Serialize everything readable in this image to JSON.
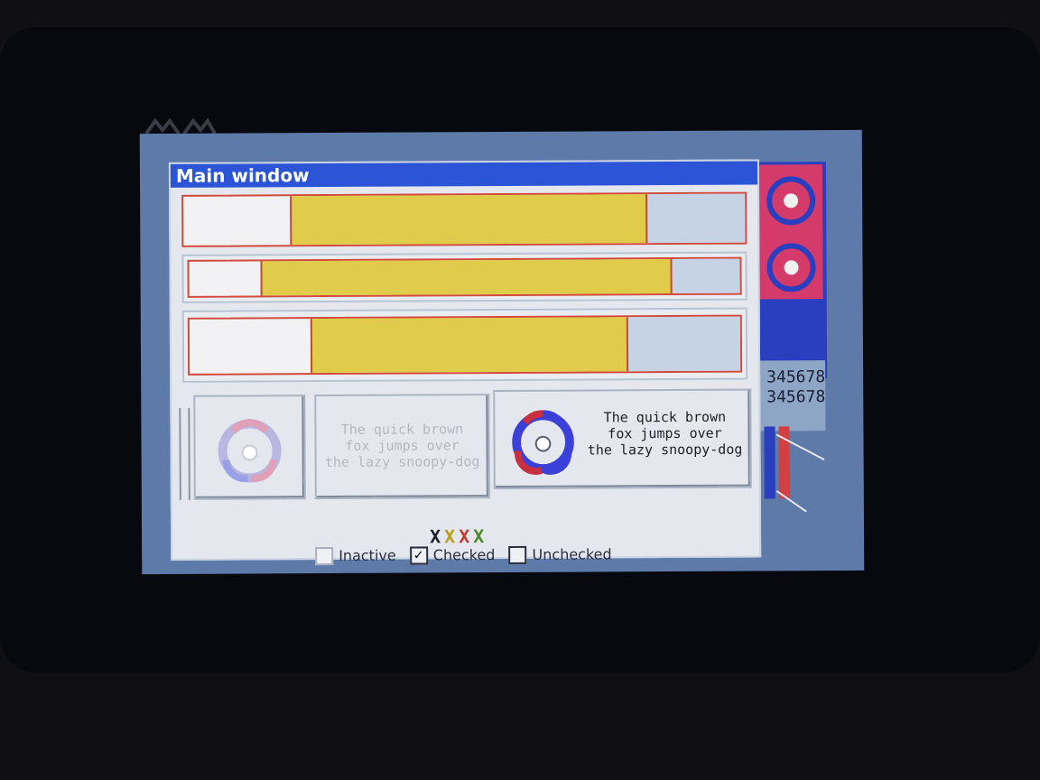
{
  "window": {
    "title": "Main window"
  },
  "progress_bars": [
    {
      "name": "bar-1",
      "level_start": 0.19,
      "level_end": 0.82
    },
    {
      "name": "bar-2",
      "level_start": 0.13,
      "level_end": 0.87
    },
    {
      "name": "bar-3",
      "level_start": 0.22,
      "level_end": 0.79
    }
  ],
  "panels": {
    "inactive_text": [
      "The quick brown",
      "fox jumps over",
      "the lazy snoopy-dog"
    ],
    "active_text": [
      "The quick brown",
      "fox jumps over",
      "the lazy snoopy-dog"
    ]
  },
  "markers": {
    "glyph": "X",
    "colors": [
      "#1d1f2a",
      "#b8a21a",
      "#c23a32",
      "#4f8a2a"
    ]
  },
  "checkboxes": [
    {
      "label": "Inactive",
      "state": "inactive",
      "mark": ""
    },
    {
      "label": "Checked",
      "state": "checked",
      "mark": "✓"
    },
    {
      "label": "Unchecked",
      "state": "unchecked",
      "mark": ""
    }
  ],
  "background": {
    "numbers": [
      "345678",
      "345678"
    ]
  },
  "colors": {
    "titlebar": "#2b54d6",
    "progress_fill": "#e0cb4a",
    "progress_border": "#d24a3c"
  },
  "icons": [
    "biohazard-icon",
    "check-icon",
    "x-icon"
  ]
}
